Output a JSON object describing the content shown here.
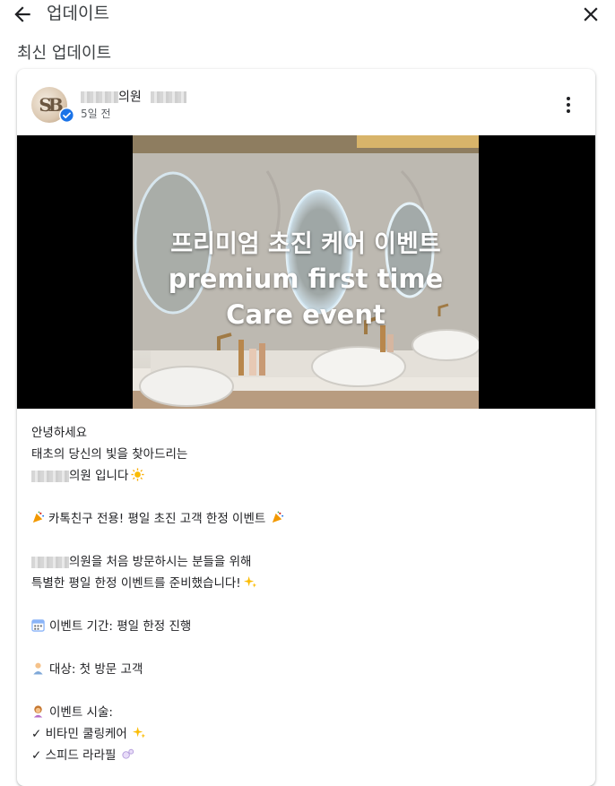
{
  "header": {
    "title": "업데이트",
    "back_icon": "arrow-back-icon",
    "close_icon": "close-icon"
  },
  "section": {
    "title": "최신 업데이트"
  },
  "post": {
    "business_name_suffix": "의원",
    "time_ago": "5일 전",
    "avatar_monogram": "SB",
    "menu_icon": "more-vert-icon",
    "image_overlay": {
      "line1": "프리미엄 초진 케어 이벤트",
      "line2": "premium first time",
      "line3": "Care event"
    },
    "body": {
      "greeting": "안녕하세요",
      "tagline": "태초의 당신의 빛을 찾아드리는",
      "intro_suffix": "의원 입니다",
      "kakao_line": "카톡친구 전용! 평일 초진 고객 한정 이벤트",
      "visit_suffix": "의원을 처음 방문하시는 분들을 위해",
      "prepared": "특별한 평일 한정 이벤트를 준비했습니다!",
      "period": "이벤트 기간: 평일 한정 진행",
      "target": "대상: 첫 방문 고객",
      "procedures": "이벤트 시술:",
      "item1": "✓ 비타민 쿨링케어",
      "item2": "✓ 스피드 라라필"
    }
  },
  "colors": {
    "verified": "#1a73e8",
    "icon": "#202124",
    "muted": "#5f6368"
  }
}
